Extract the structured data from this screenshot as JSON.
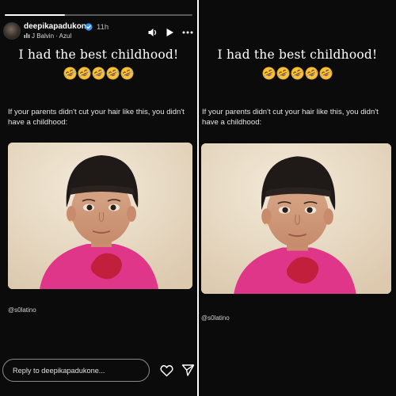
{
  "left_story": {
    "progress": 0.32,
    "username": "deepikapadukone",
    "posted_ago": "11h",
    "music": "J Balvin · Azul",
    "caption": "I had the best childhood!",
    "emoji_count": 5,
    "emoji_name": "rolling-on-floor-laughing",
    "tweet_text": "If your parents didn't cut your hair like this, you didn't have a childhood:",
    "handle": "@s0latino",
    "reply_placeholder": "Reply to deepikapadukone..."
  },
  "right_story": {
    "caption": "I had the best childhood!",
    "emoji_count": 5,
    "tweet_text": "If your parents didn't cut your hair like this, you didn't have a childhood:",
    "handle": "@s0latino"
  },
  "icons": {
    "verified": "verified-badge-icon",
    "sound": "speaker-icon",
    "play": "play-icon",
    "more": "more-dots-icon",
    "like": "heart-icon",
    "send": "send-icon"
  },
  "colors": {
    "story_background": "#0b0b0b",
    "verified_blue": "#3797f0",
    "shirt_pink": "#e0368a"
  }
}
